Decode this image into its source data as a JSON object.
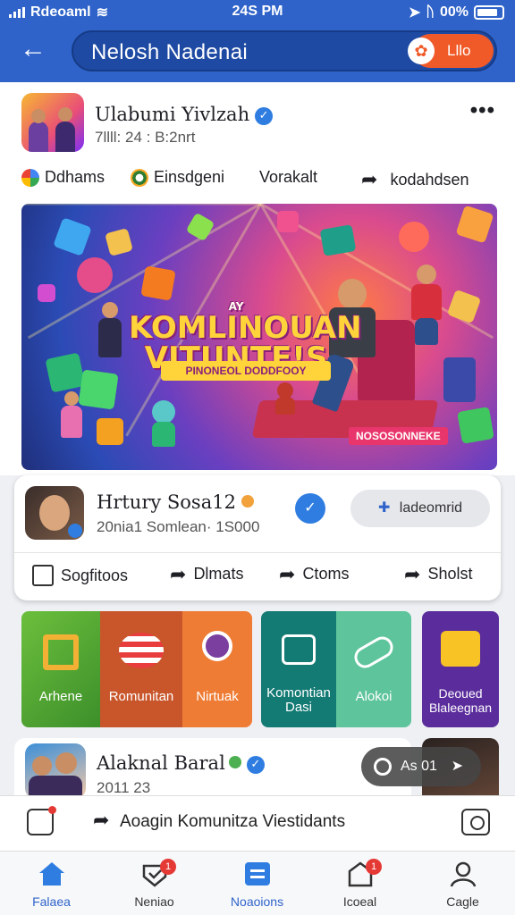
{
  "status_bar": {
    "carrier": "Rdeoaml",
    "time": "24S PM",
    "battery": "00%"
  },
  "header": {
    "title": "Nelosh Nadenai",
    "action_label": "Lllo"
  },
  "post": {
    "author": "Ulabumi Yivlzah",
    "meta": "7llll: 24 :   B:2nrt",
    "tags": [
      "Ddhams",
      "Einsdgeni",
      "Vorakalt",
      "kodahdsen"
    ],
    "banner": {
      "eyebrow": "AY",
      "title_line1": "KOMLINOUAN",
      "title_line2": "VITUNTE!S",
      "subtitle": "PINONEOL DODDFOOY",
      "badge": "NOSOSONNEKE"
    }
  },
  "group_card": {
    "name": "Hrtury Sosa12",
    "meta": "20nia1 Somlean· 1S000",
    "join_label": "ladeomrid",
    "actions": [
      "Sogfitoos",
      "Dlmats",
      "Ctoms",
      "Sholst"
    ]
  },
  "tiles": [
    {
      "label": "Arhene"
    },
    {
      "label": "Romunitan"
    },
    {
      "label": "Nirtuak"
    },
    {
      "label": "Komontian Dasi"
    },
    {
      "label": "Alokoi"
    },
    {
      "label": "Deoued Blaleegnan"
    }
  ],
  "post2": {
    "author": "Alaknal Baral",
    "meta": "2011 23",
    "float_label": "As 01"
  },
  "compose": {
    "placeholder": "Aoagin Komunitza Viestidants"
  },
  "tabbar": {
    "items": [
      {
        "label": "Falaea",
        "badge": ""
      },
      {
        "label": "Neniao",
        "badge": "1"
      },
      {
        "label": "Noaoions",
        "badge": ""
      },
      {
        "label": "Icoeal",
        "badge": "1"
      },
      {
        "label": "Cagle",
        "badge": ""
      }
    ]
  },
  "colors": {
    "brand_blue": "#2f63c9",
    "accent_orange": "#f05a28",
    "verified_blue": "#2f7de1",
    "badge_red": "#e53935"
  }
}
